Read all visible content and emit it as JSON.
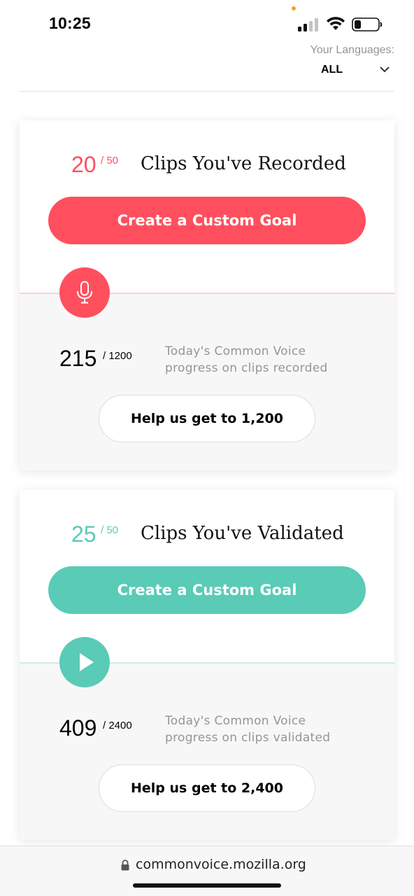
{
  "status_bar": {
    "time": "10:25",
    "icons": [
      "signal-icon",
      "wifi-icon",
      "battery-icon"
    ]
  },
  "language_selector": {
    "label": "Your Languages:",
    "value": "ALL",
    "icon": "chevron-down-icon"
  },
  "colors": {
    "record_accent": "#ff4f5e",
    "validate_accent": "#59cbb7",
    "record_line": "#ffd0d4",
    "validate_line": "#c9efe8"
  },
  "cards": [
    {
      "goal_count": "20",
      "goal_total": "/ 50",
      "goal_title": "Clips You've Recorded",
      "goal_button": "Create a Custom Goal",
      "icon": "microphone-icon",
      "stat_count": "215",
      "stat_total": "/ 1200",
      "stat_description": "Today's Common Voice progress on clips recorded",
      "help_button": "Help us get to 1,200"
    },
    {
      "goal_count": "25",
      "goal_total": "/ 50",
      "goal_title": "Clips You've Validated",
      "goal_button": "Create a Custom Goal",
      "icon": "play-icon",
      "stat_count": "409",
      "stat_total": "/ 2400",
      "stat_description": "Today's Common Voice progress on clips validated",
      "help_button": "Help us get to 2,400"
    }
  ],
  "url_bar": {
    "url": "commonvoice.mozilla.org",
    "icon": "lock-icon"
  }
}
